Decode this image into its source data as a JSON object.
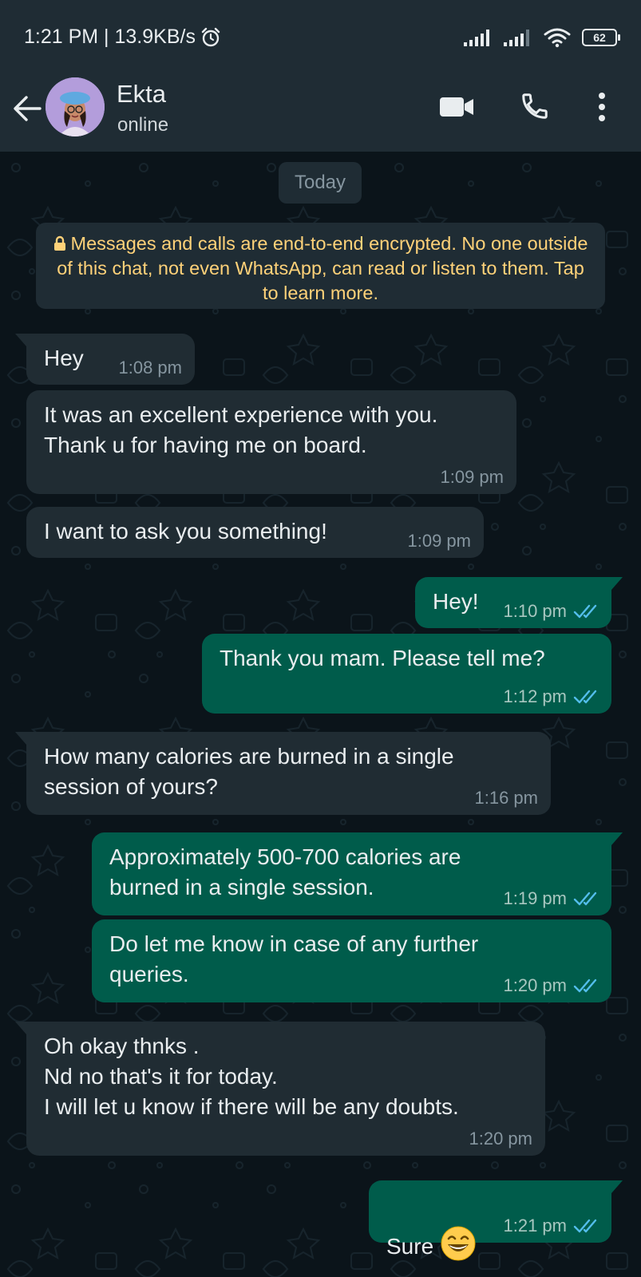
{
  "status_bar": {
    "time_speed": "1:21 PM | 13.9KB/s",
    "battery": "62"
  },
  "header": {
    "contact_name": "Ekta",
    "contact_status": "online"
  },
  "chat": {
    "date_chip": "Today",
    "encryption_notice": "Messages and calls are end-to-end encrypted. No one outside of this chat, not even WhatsApp, can read or listen to them. Tap to learn more.",
    "messages": [
      {
        "direction": "incoming",
        "text": "Hey",
        "time": "1:08 pm"
      },
      {
        "direction": "incoming",
        "text": "It was an excellent experience with you.\nThank u for having me on board.",
        "time": "1:09 pm"
      },
      {
        "direction": "incoming",
        "text": "I want to ask you something!",
        "time": "1:09 pm"
      },
      {
        "direction": "outgoing",
        "text": "Hey!",
        "time": "1:10 pm",
        "status": "read"
      },
      {
        "direction": "outgoing",
        "text": "Thank you mam. Please tell me?",
        "time": "1:12 pm",
        "status": "read"
      },
      {
        "direction": "incoming",
        "text": "How many calories are burned in a single\nsession of yours?",
        "time": "1:16 pm"
      },
      {
        "direction": "outgoing",
        "text": "Approximately 500-700 calories are\nburned in a single session.",
        "time": "1:19 pm",
        "status": "read"
      },
      {
        "direction": "outgoing",
        "text": "Do let me know in case of any further\nqueries.",
        "time": "1:20 pm",
        "status": "read"
      },
      {
        "direction": "incoming",
        "text": "Oh okay thnks .\nNd no that's it for today.\nI will let u know if there will be any doubts.",
        "time": "1:20 pm"
      },
      {
        "direction": "outgoing",
        "text": "Sure",
        "emoji": "grinning-face-icon",
        "time": "1:21 pm",
        "status": "read"
      }
    ]
  },
  "colors": {
    "header_bg": "#1f2c34",
    "chat_bg": "#0b141a",
    "incoming_bubble": "#202c33",
    "outgoing_bubble": "#005c4b",
    "read_tick": "#53bdeb",
    "encryption_text": "#ffd279"
  }
}
